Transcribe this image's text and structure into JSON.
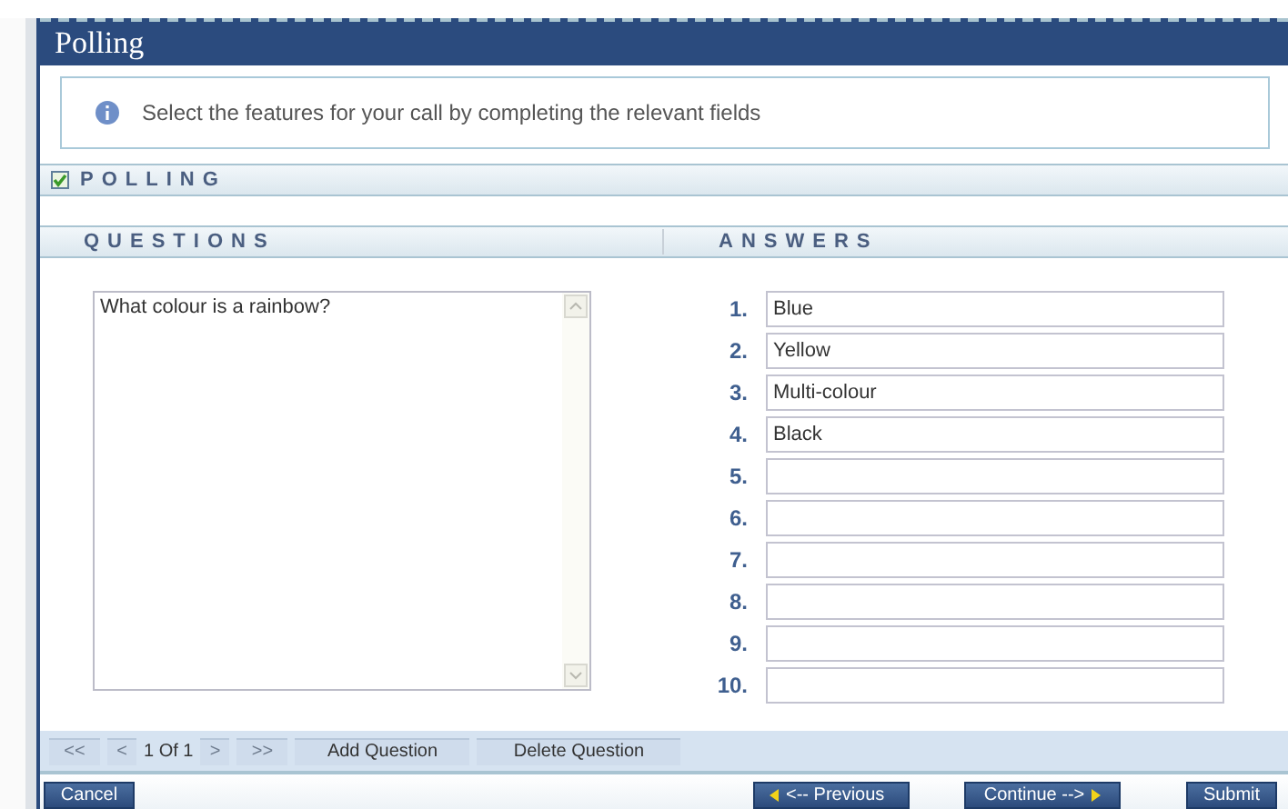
{
  "window": {
    "title": "Polling"
  },
  "info": {
    "text": "Select the features for your call by completing the relevant fields"
  },
  "section": {
    "label": "POLLING",
    "checked": true
  },
  "columns": [
    "QUESTIONS",
    "ANSWERS"
  ],
  "question": {
    "value": "What colour is a rainbow?"
  },
  "answers": [
    {
      "number": "1.",
      "value": "Blue"
    },
    {
      "number": "2.",
      "value": "Yellow"
    },
    {
      "number": "3.",
      "value": "Multi-colour"
    },
    {
      "number": "4.",
      "value": "Black"
    },
    {
      "number": "5."
    },
    {
      "number": "6."
    },
    {
      "number": "7."
    },
    {
      "number": "8."
    },
    {
      "number": "9."
    },
    {
      "number": "10."
    }
  ],
  "pager": {
    "first": "<<",
    "prev": "<",
    "position": "1 Of 1",
    "next": ">",
    "last": ">>",
    "disabled": true
  },
  "question_buttons": [
    "Add Question",
    "Delete Question"
  ],
  "footer": {
    "cancel": "Cancel",
    "previous": "<-- Previous",
    "continue": "Continue -->",
    "submit": "Submit"
  }
}
